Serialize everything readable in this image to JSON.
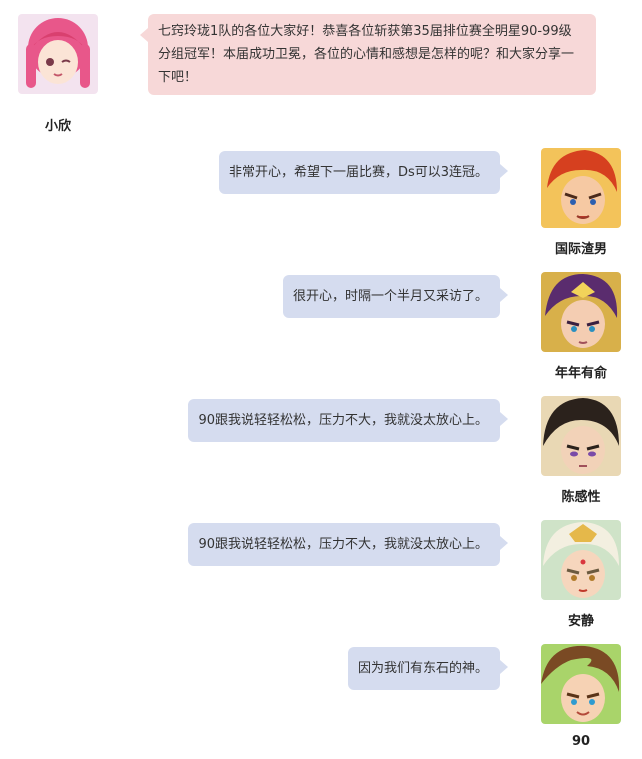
{
  "conversation": {
    "messages": [
      {
        "speaker": "小欣",
        "avatar_icon": "pink-hair-girl-avatar-icon",
        "side": "left",
        "text": "七窍玲珑1队的各位大家好！恭喜各位斩获第35届排位赛全明星90-99级分组冠军！本届成功卫冕，各位的心情和感想是怎样的呢？和大家分享一下吧！"
      },
      {
        "speaker": "国际渣男",
        "avatar_icon": "red-hair-warrior-avatar-icon",
        "side": "right",
        "text": "非常开心，希望下一届比赛，Ds可以3连冠。"
      },
      {
        "speaker": "年年有俞",
        "avatar_icon": "purple-hair-warrior-avatar-icon",
        "side": "right",
        "text": "很开心，时隔一个半月又采访了。"
      },
      {
        "speaker": "陈感性",
        "avatar_icon": "dark-hair-scholar-avatar-icon",
        "side": "right",
        "text": "90跟我说轻轻松松，压力不大，我就没太放心上。"
      },
      {
        "speaker": "安静",
        "avatar_icon": "white-hair-monk-avatar-icon",
        "side": "right",
        "text": "90跟我说轻轻松松，压力不大，我就没太放心上。"
      },
      {
        "speaker": "90",
        "avatar_icon": "brown-hair-boy-avatar-icon",
        "side": "right",
        "text": "因为我们有东石的神。"
      }
    ]
  },
  "colors": {
    "left_bubble": "#f7d8d8",
    "right_bubble": "#d5dcef"
  }
}
